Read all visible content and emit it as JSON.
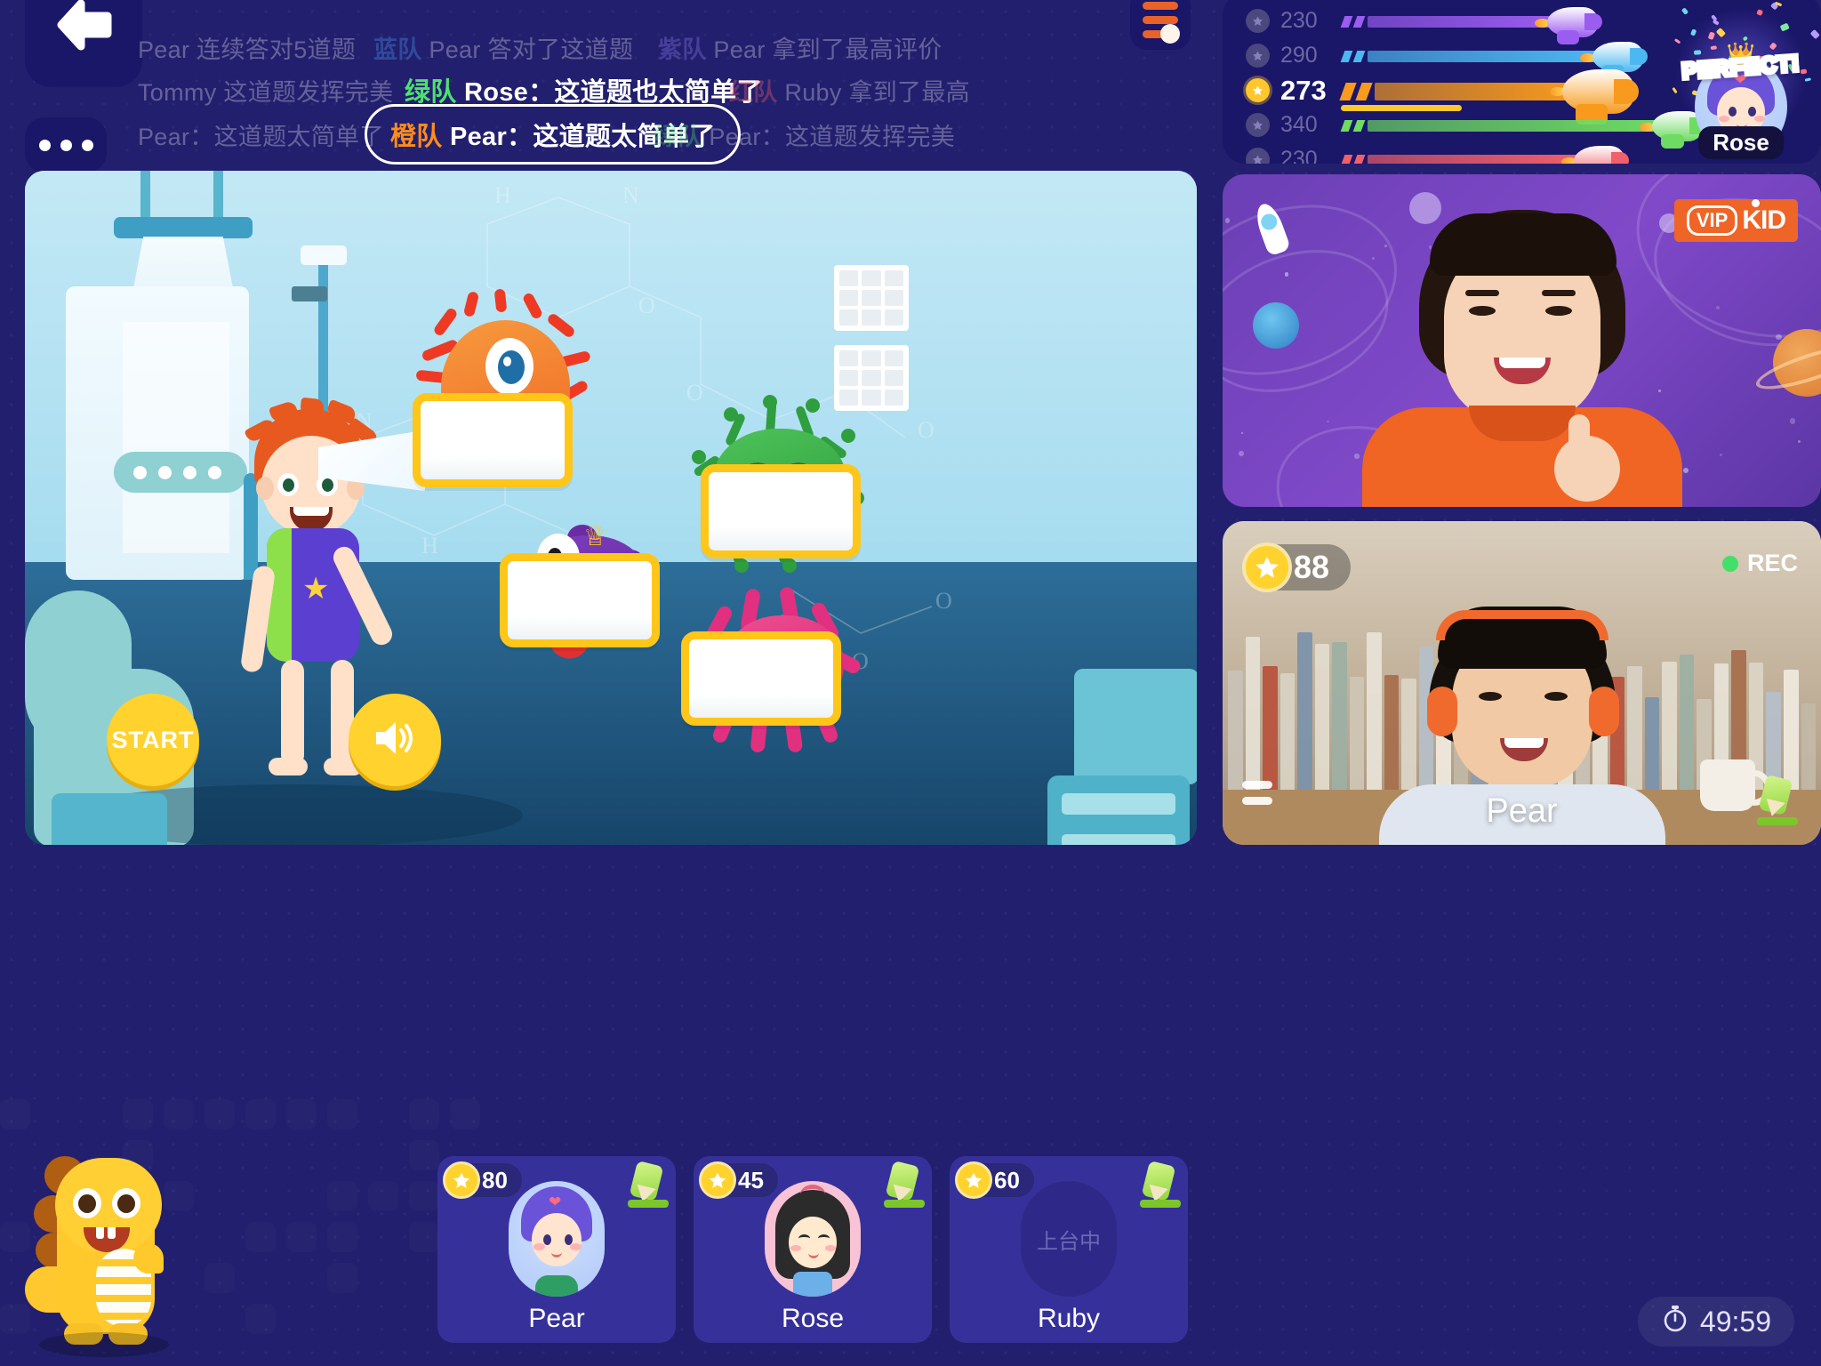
{
  "nav": {
    "back_icon": "back-arrow-icon",
    "more_icon": "more-dots-icon",
    "settings_icon": "settings-toggle-icon"
  },
  "messages": {
    "row1": [
      {
        "team": "",
        "text": "Pear 连续答对5道题",
        "style": "faint"
      },
      {
        "team": "蓝队",
        "text": "Pear 答对了这道题",
        "style": "faint",
        "color": "blue"
      },
      {
        "team": "紫队",
        "text": "Pear 拿到了最高评价",
        "style": "faint",
        "color": "purple"
      }
    ],
    "row2": [
      {
        "team": "",
        "text": "Tommy 这道题发挥完美",
        "style": "faint"
      },
      {
        "team": "绿队",
        "text": "Rose：这道题也太简单了",
        "style": "bright",
        "color": "green"
      },
      {
        "team": "红队",
        "text": "Ruby 拿到了最高",
        "style": "faint",
        "color": "red"
      }
    ],
    "row3": [
      {
        "team": "",
        "text": "Pear：这道题太简单了",
        "style": "faint"
      },
      {
        "team": "橙队",
        "text": "Pear：这道题太简单了",
        "style": "pill",
        "color": "orange"
      },
      {
        "team": "绿队",
        "text": "Pear：这道题发挥完美",
        "style": "faint",
        "color": "green"
      }
    ]
  },
  "race": {
    "rows": [
      {
        "score": "230",
        "color": "#9b5cf0",
        "progress": 58,
        "leader": false
      },
      {
        "score": "290",
        "color": "#4db8f0",
        "progress": 70,
        "leader": false
      },
      {
        "score": "273",
        "color": "#f79a1e",
        "progress": 62,
        "leader": true
      },
      {
        "score": "340",
        "color": "#6edb62",
        "progress": 86,
        "leader": false
      },
      {
        "score": "230",
        "color": "#f0606a",
        "progress": 65,
        "leader": false
      }
    ],
    "winner": {
      "badge": "PERFECT!",
      "name": "Rose"
    }
  },
  "stage": {
    "start_label": "START",
    "sound_icon": "speaker-icon",
    "cards": [
      "",
      "",
      "",
      ""
    ]
  },
  "teacher_video": {
    "brand_vip": "VIP",
    "brand_kid": "KID"
  },
  "student_video": {
    "stars": "88",
    "rec_label": "REC",
    "name": "Pear",
    "pencil_icon": "pencil-icon",
    "rec_dot_color": "#42e06a"
  },
  "students": [
    {
      "name": "Pear",
      "points": "80",
      "avatar": "pear",
      "empty": false
    },
    {
      "name": "Rose",
      "points": "45",
      "avatar": "rose",
      "empty": false
    },
    {
      "name": "Ruby",
      "points": "60",
      "avatar": "none",
      "empty": true,
      "waiting": "上台中"
    }
  ],
  "timer": {
    "icon": "stopwatch-icon",
    "value": "49:59"
  }
}
